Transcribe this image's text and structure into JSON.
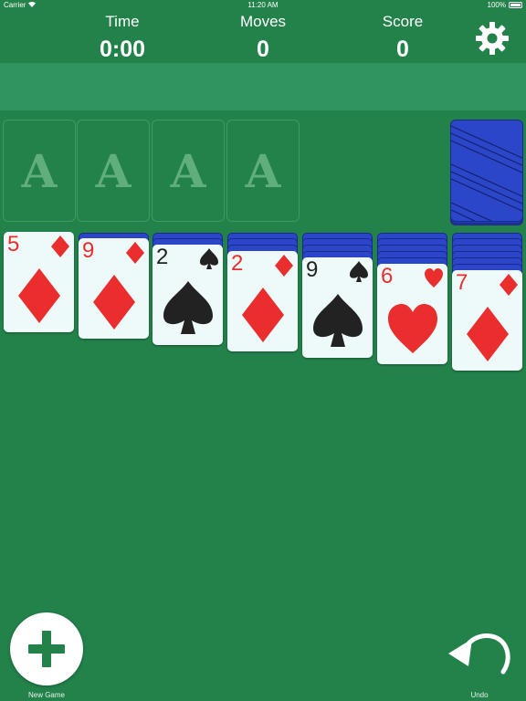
{
  "status_bar": {
    "carrier": "Carrier",
    "time": "11:20 AM",
    "battery": "100%"
  },
  "header": {
    "time_label": "Time",
    "time_value": "0:00",
    "moves_label": "Moves",
    "moves_value": "0",
    "score_label": "Score",
    "score_value": "0",
    "settings_icon": "gear-icon"
  },
  "foundations": [
    {
      "placeholder": "A"
    },
    {
      "placeholder": "A"
    },
    {
      "placeholder": "A"
    },
    {
      "placeholder": "A"
    }
  ],
  "stock": {
    "state": "face-down",
    "color": "#2b46c8"
  },
  "tableau": [
    {
      "face_down_count": 0,
      "top_card": {
        "rank": "5",
        "suit": "diamond",
        "color": "red"
      }
    },
    {
      "face_down_count": 1,
      "top_card": {
        "rank": "9",
        "suit": "diamond",
        "color": "red"
      }
    },
    {
      "face_down_count": 2,
      "top_card": {
        "rank": "2",
        "suit": "spade",
        "color": "black"
      }
    },
    {
      "face_down_count": 3,
      "top_card": {
        "rank": "2",
        "suit": "diamond",
        "color": "red"
      }
    },
    {
      "face_down_count": 4,
      "top_card": {
        "rank": "9",
        "suit": "spade",
        "color": "black"
      }
    },
    {
      "face_down_count": 5,
      "top_card": {
        "rank": "6",
        "suit": "heart",
        "color": "red"
      }
    },
    {
      "face_down_count": 6,
      "top_card": {
        "rank": "7",
        "suit": "diamond",
        "color": "red"
      }
    }
  ],
  "footer": {
    "new_game_label": "New Game",
    "new_game_icon": "plus-icon",
    "undo_label": "Undo",
    "undo_icon": "undo-arrow-icon"
  },
  "colors": {
    "felt": "#23814a",
    "banner": "#2f9460",
    "card_face": "#eefaf9",
    "card_back": "#2b46c8",
    "red_suit": "#ea2e2e",
    "black_suit": "#222222"
  }
}
